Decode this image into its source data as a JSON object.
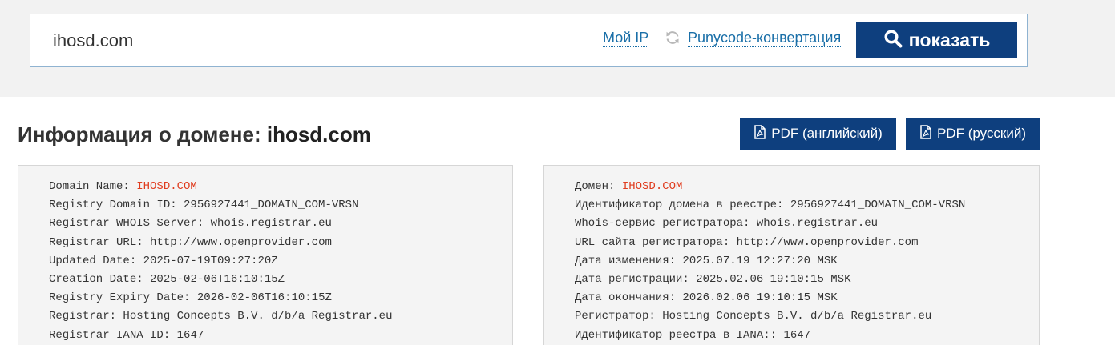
{
  "search": {
    "value": "ihosd.com",
    "my_ip_label": "Мой IP",
    "punycode_label": "Punycode-конвертация",
    "show_label": "показать"
  },
  "title": {
    "prefix": "Информация о домене:",
    "domain": "ihosd.com"
  },
  "pdf": {
    "english_label": "PDF (английский)",
    "russian_label": "PDF (русский)"
  },
  "icons": [
    "refresh-icon",
    "search-icon",
    "pdf-file-icon"
  ],
  "colors": {
    "accent": "#0e3f7e",
    "link": "#1a6fa8",
    "highlight": "#e03c1e",
    "panel_bg": "#f4f4f4"
  },
  "whois_en": [
    {
      "label": "Domain Name: ",
      "value": "IHOSD.COM",
      "highlight": true
    },
    {
      "label": "Registry Domain ID: ",
      "value": "2956927441_DOMAIN_COM-VRSN"
    },
    {
      "label": "Registrar WHOIS Server: ",
      "value": "whois.registrar.eu"
    },
    {
      "label": "Registrar URL: ",
      "value": "http://www.openprovider.com"
    },
    {
      "label": "Updated Date: ",
      "value": "2025-07-19T09:27:20Z"
    },
    {
      "label": "Creation Date: ",
      "value": "2025-02-06T16:10:15Z"
    },
    {
      "label": "Registry Expiry Date: ",
      "value": "2026-02-06T16:10:15Z"
    },
    {
      "label": "Registrar: ",
      "value": "Hosting Concepts B.V. d/b/a Registrar.eu"
    },
    {
      "label": "Registrar IANA ID: ",
      "value": "1647"
    }
  ],
  "whois_ru": [
    {
      "label": "Домен: ",
      "value": "IHOSD.COM",
      "highlight": true
    },
    {
      "label": "Идентификатор домена в реестре: ",
      "value": "2956927441_DOMAIN_COM-VRSN"
    },
    {
      "label": "Whois-сервис регистратора: ",
      "value": "whois.registrar.eu"
    },
    {
      "label": "URL сайта регистратора: ",
      "value": "http://www.openprovider.com"
    },
    {
      "label": "Дата изменения: ",
      "value": "2025.07.19 12:27:20 MSK"
    },
    {
      "label": "Дата регистрации: ",
      "value": "2025.02.06 19:10:15 MSK"
    },
    {
      "label": "Дата окончания: ",
      "value": "2026.02.06 19:10:15 MSK"
    },
    {
      "label": "Регистратор: ",
      "value": "Hosting Concepts B.V. d/b/a Registrar.eu"
    },
    {
      "label": "Идентификатор реестра в IANA:: ",
      "value": "1647"
    }
  ]
}
